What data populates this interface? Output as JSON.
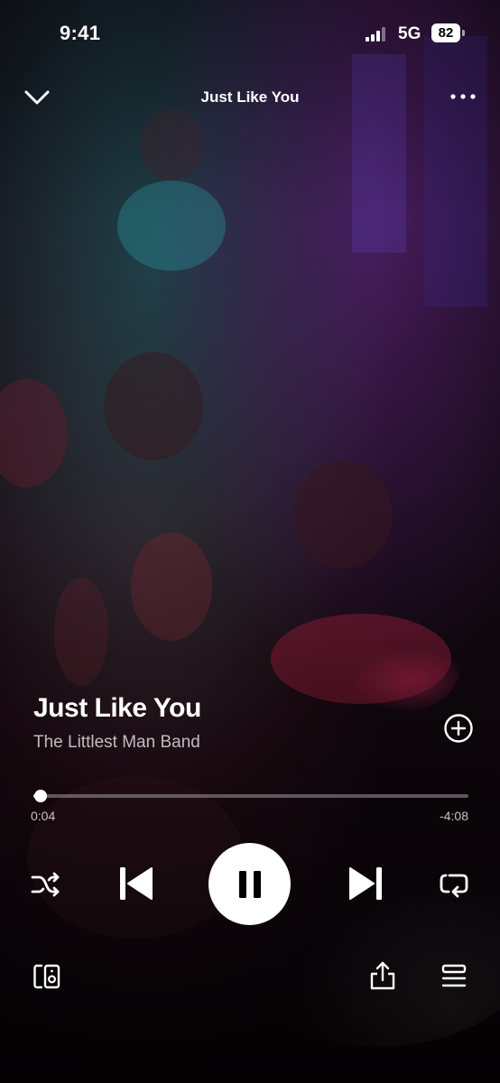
{
  "status_bar": {
    "time": "9:41",
    "network": "5G",
    "battery": "82"
  },
  "nav": {
    "title": "Just Like You",
    "collapse_icon": "chevron-down-icon",
    "more_icon": "more-icon"
  },
  "track": {
    "title": "Just Like You",
    "artist": "The Littlest Man Band"
  },
  "playback": {
    "elapsed": "0:04",
    "remaining": "-4:08",
    "progress_fraction": 0.016,
    "state": "playing"
  },
  "controls": {
    "shuffle_icon": "shuffle-icon",
    "previous_icon": "previous-icon",
    "pause_icon": "pause-icon",
    "next_icon": "next-icon",
    "repeat_icon": "repeat-icon"
  },
  "footer": {
    "connect_icon": "connect-device-icon",
    "share_icon": "share-icon",
    "queue_icon": "queue-icon"
  },
  "colors": {
    "text": "#ffffff",
    "muted_text": "#b8b8b8",
    "button_bg": "#ffffff",
    "button_icon": "#000000"
  }
}
